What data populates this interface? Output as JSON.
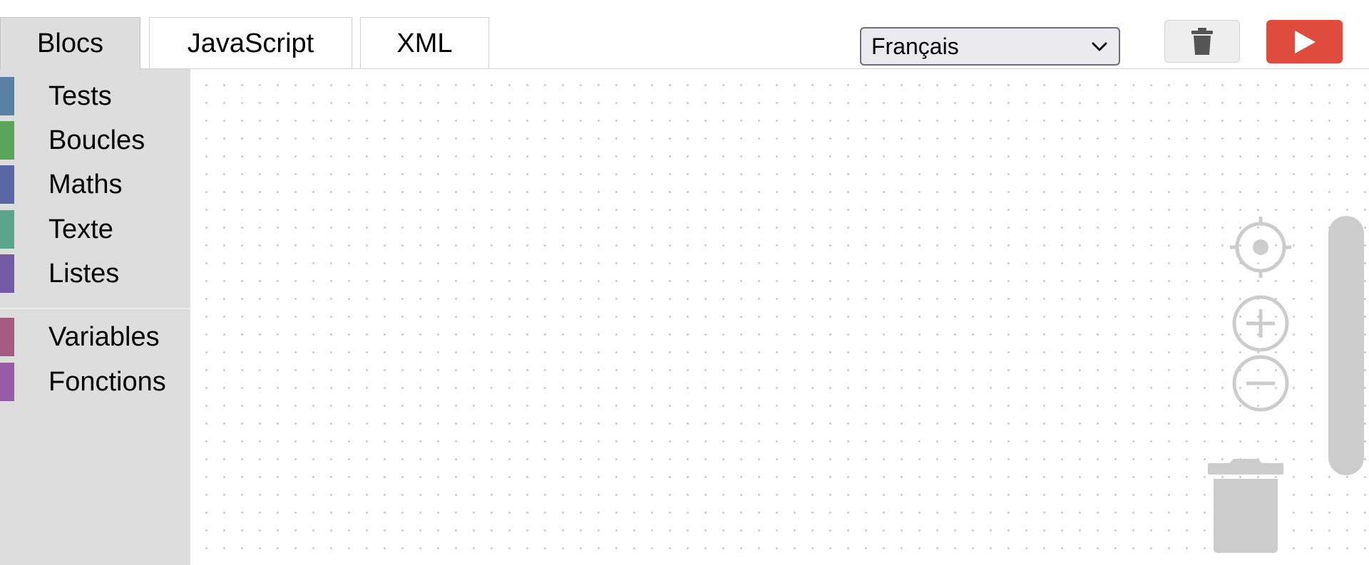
{
  "tabs": {
    "blocs": "Blocs",
    "javascript": "JavaScript",
    "xml": "XML"
  },
  "language": {
    "selected": "Français"
  },
  "toolbar": {
    "trash_icon": "trash-icon",
    "run_icon": "play-icon"
  },
  "colors": {
    "run_button": "#df4b3c",
    "tests": "#5b80a5",
    "boucles": "#5ba55b",
    "maths": "#5b67a5",
    "texte": "#5ba58c",
    "listes": "#745ba5",
    "variables": "#a55b80",
    "fonctions": "#995ba5"
  },
  "toolbox": {
    "categories": [
      {
        "label": "Tests"
      },
      {
        "label": "Boucles"
      },
      {
        "label": "Maths"
      },
      {
        "label": "Texte"
      },
      {
        "label": "Listes"
      },
      {
        "label": "Variables"
      },
      {
        "label": "Fonctions"
      }
    ]
  },
  "workspace": {
    "controls": [
      "target-icon",
      "zoom-in-icon",
      "zoom-out-icon",
      "trash-can-icon"
    ]
  }
}
